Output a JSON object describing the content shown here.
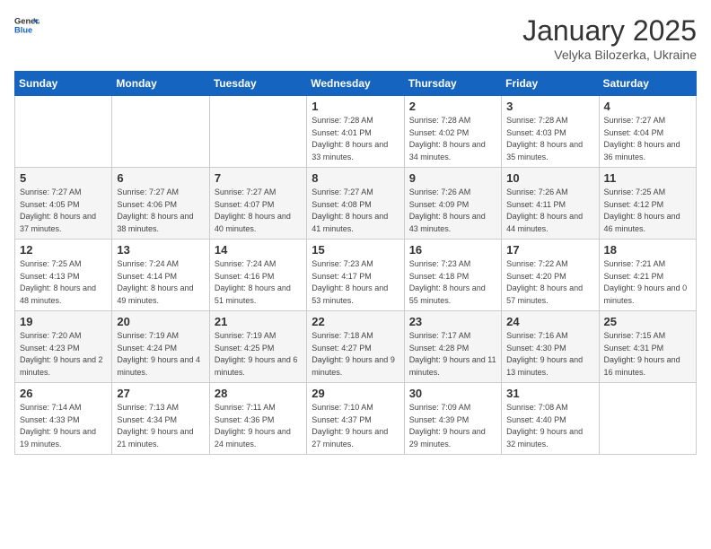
{
  "logo": {
    "general": "General",
    "blue": "Blue"
  },
  "title": "January 2025",
  "subtitle": "Velyka Bilozerka, Ukraine",
  "days_header": [
    "Sunday",
    "Monday",
    "Tuesday",
    "Wednesday",
    "Thursday",
    "Friday",
    "Saturday"
  ],
  "weeks": [
    [
      {
        "day": "",
        "sunrise": "",
        "sunset": "",
        "daylight": ""
      },
      {
        "day": "",
        "sunrise": "",
        "sunset": "",
        "daylight": ""
      },
      {
        "day": "",
        "sunrise": "",
        "sunset": "",
        "daylight": ""
      },
      {
        "day": "1",
        "sunrise": "Sunrise: 7:28 AM",
        "sunset": "Sunset: 4:01 PM",
        "daylight": "Daylight: 8 hours and 33 minutes."
      },
      {
        "day": "2",
        "sunrise": "Sunrise: 7:28 AM",
        "sunset": "Sunset: 4:02 PM",
        "daylight": "Daylight: 8 hours and 34 minutes."
      },
      {
        "day": "3",
        "sunrise": "Sunrise: 7:28 AM",
        "sunset": "Sunset: 4:03 PM",
        "daylight": "Daylight: 8 hours and 35 minutes."
      },
      {
        "day": "4",
        "sunrise": "Sunrise: 7:27 AM",
        "sunset": "Sunset: 4:04 PM",
        "daylight": "Daylight: 8 hours and 36 minutes."
      }
    ],
    [
      {
        "day": "5",
        "sunrise": "Sunrise: 7:27 AM",
        "sunset": "Sunset: 4:05 PM",
        "daylight": "Daylight: 8 hours and 37 minutes."
      },
      {
        "day": "6",
        "sunrise": "Sunrise: 7:27 AM",
        "sunset": "Sunset: 4:06 PM",
        "daylight": "Daylight: 8 hours and 38 minutes."
      },
      {
        "day": "7",
        "sunrise": "Sunrise: 7:27 AM",
        "sunset": "Sunset: 4:07 PM",
        "daylight": "Daylight: 8 hours and 40 minutes."
      },
      {
        "day": "8",
        "sunrise": "Sunrise: 7:27 AM",
        "sunset": "Sunset: 4:08 PM",
        "daylight": "Daylight: 8 hours and 41 minutes."
      },
      {
        "day": "9",
        "sunrise": "Sunrise: 7:26 AM",
        "sunset": "Sunset: 4:09 PM",
        "daylight": "Daylight: 8 hours and 43 minutes."
      },
      {
        "day": "10",
        "sunrise": "Sunrise: 7:26 AM",
        "sunset": "Sunset: 4:11 PM",
        "daylight": "Daylight: 8 hours and 44 minutes."
      },
      {
        "day": "11",
        "sunrise": "Sunrise: 7:25 AM",
        "sunset": "Sunset: 4:12 PM",
        "daylight": "Daylight: 8 hours and 46 minutes."
      }
    ],
    [
      {
        "day": "12",
        "sunrise": "Sunrise: 7:25 AM",
        "sunset": "Sunset: 4:13 PM",
        "daylight": "Daylight: 8 hours and 48 minutes."
      },
      {
        "day": "13",
        "sunrise": "Sunrise: 7:24 AM",
        "sunset": "Sunset: 4:14 PM",
        "daylight": "Daylight: 8 hours and 49 minutes."
      },
      {
        "day": "14",
        "sunrise": "Sunrise: 7:24 AM",
        "sunset": "Sunset: 4:16 PM",
        "daylight": "Daylight: 8 hours and 51 minutes."
      },
      {
        "day": "15",
        "sunrise": "Sunrise: 7:23 AM",
        "sunset": "Sunset: 4:17 PM",
        "daylight": "Daylight: 8 hours and 53 minutes."
      },
      {
        "day": "16",
        "sunrise": "Sunrise: 7:23 AM",
        "sunset": "Sunset: 4:18 PM",
        "daylight": "Daylight: 8 hours and 55 minutes."
      },
      {
        "day": "17",
        "sunrise": "Sunrise: 7:22 AM",
        "sunset": "Sunset: 4:20 PM",
        "daylight": "Daylight: 8 hours and 57 minutes."
      },
      {
        "day": "18",
        "sunrise": "Sunrise: 7:21 AM",
        "sunset": "Sunset: 4:21 PM",
        "daylight": "Daylight: 9 hours and 0 minutes."
      }
    ],
    [
      {
        "day": "19",
        "sunrise": "Sunrise: 7:20 AM",
        "sunset": "Sunset: 4:23 PM",
        "daylight": "Daylight: 9 hours and 2 minutes."
      },
      {
        "day": "20",
        "sunrise": "Sunrise: 7:19 AM",
        "sunset": "Sunset: 4:24 PM",
        "daylight": "Daylight: 9 hours and 4 minutes."
      },
      {
        "day": "21",
        "sunrise": "Sunrise: 7:19 AM",
        "sunset": "Sunset: 4:25 PM",
        "daylight": "Daylight: 9 hours and 6 minutes."
      },
      {
        "day": "22",
        "sunrise": "Sunrise: 7:18 AM",
        "sunset": "Sunset: 4:27 PM",
        "daylight": "Daylight: 9 hours and 9 minutes."
      },
      {
        "day": "23",
        "sunrise": "Sunrise: 7:17 AM",
        "sunset": "Sunset: 4:28 PM",
        "daylight": "Daylight: 9 hours and 11 minutes."
      },
      {
        "day": "24",
        "sunrise": "Sunrise: 7:16 AM",
        "sunset": "Sunset: 4:30 PM",
        "daylight": "Daylight: 9 hours and 13 minutes."
      },
      {
        "day": "25",
        "sunrise": "Sunrise: 7:15 AM",
        "sunset": "Sunset: 4:31 PM",
        "daylight": "Daylight: 9 hours and 16 minutes."
      }
    ],
    [
      {
        "day": "26",
        "sunrise": "Sunrise: 7:14 AM",
        "sunset": "Sunset: 4:33 PM",
        "daylight": "Daylight: 9 hours and 19 minutes."
      },
      {
        "day": "27",
        "sunrise": "Sunrise: 7:13 AM",
        "sunset": "Sunset: 4:34 PM",
        "daylight": "Daylight: 9 hours and 21 minutes."
      },
      {
        "day": "28",
        "sunrise": "Sunrise: 7:11 AM",
        "sunset": "Sunset: 4:36 PM",
        "daylight": "Daylight: 9 hours and 24 minutes."
      },
      {
        "day": "29",
        "sunrise": "Sunrise: 7:10 AM",
        "sunset": "Sunset: 4:37 PM",
        "daylight": "Daylight: 9 hours and 27 minutes."
      },
      {
        "day": "30",
        "sunrise": "Sunrise: 7:09 AM",
        "sunset": "Sunset: 4:39 PM",
        "daylight": "Daylight: 9 hours and 29 minutes."
      },
      {
        "day": "31",
        "sunrise": "Sunrise: 7:08 AM",
        "sunset": "Sunset: 4:40 PM",
        "daylight": "Daylight: 9 hours and 32 minutes."
      },
      {
        "day": "",
        "sunrise": "",
        "sunset": "",
        "daylight": ""
      }
    ]
  ]
}
